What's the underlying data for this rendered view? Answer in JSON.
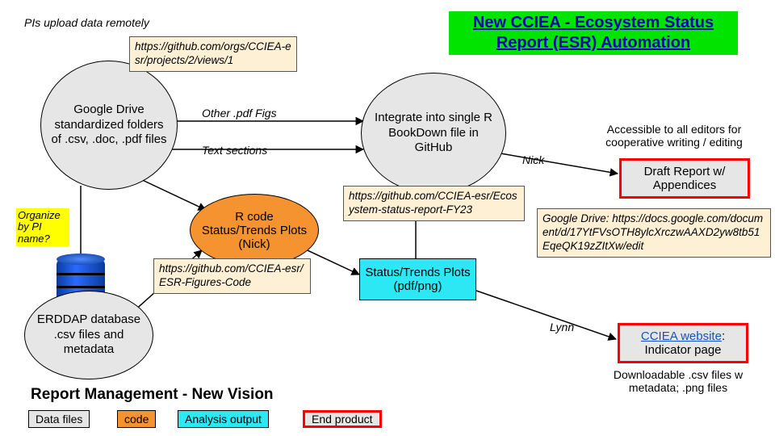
{
  "title": "New CCIEA - Ecosystem Status Report (ESR) Automation",
  "topNote": "PIs upload data remotely",
  "sticky": "Organize by PI name?",
  "nodes": {
    "gdrive": "Google Drive standardized folders of .csv, .doc, .pdf files",
    "rcode": "R code Status/Trends Plots (Nick)",
    "integrate": "Integrate into single R BookDown file in GitHub",
    "erddap": "ERDDAP database .csv files and metadata",
    "plots": "Status/Trends Plots (pdf/png)",
    "draft": "Draft Report w/ Appendices",
    "websiteLink": "CCIEA website",
    "websiteRest": ": Indicator page"
  },
  "urls": {
    "projects": "https://github.com/orgs/CCIEA-esr/projects/2/views/1",
    "esrRepo": "https://github.com/CCIEA-esr/Ecosystem-status-report-FY23",
    "figRepo": "https://github.com/CCIEA-esr/ESR-Figures-Code",
    "gdoc": "Google Drive: https://docs.google.com/document/d/17YtFVsOTH8ylcXrczwAAXD2yw8tb51EqeQK19zZItXw/edit"
  },
  "edgeLabels": {
    "otherPdf": "Other .pdf Figs",
    "textSections": "Text sections",
    "nick": "Nick",
    "lynn": "Lynn"
  },
  "captions": {
    "editors": "Accessible to all editors for cooperative writing / editing",
    "downloads": "Downloadable .csv files w metadata; .png files"
  },
  "sectionTitle": "Report Management - New Vision",
  "legend": {
    "data": "Data files",
    "code": "code",
    "analysis": "Analysis output",
    "end": "End product"
  }
}
